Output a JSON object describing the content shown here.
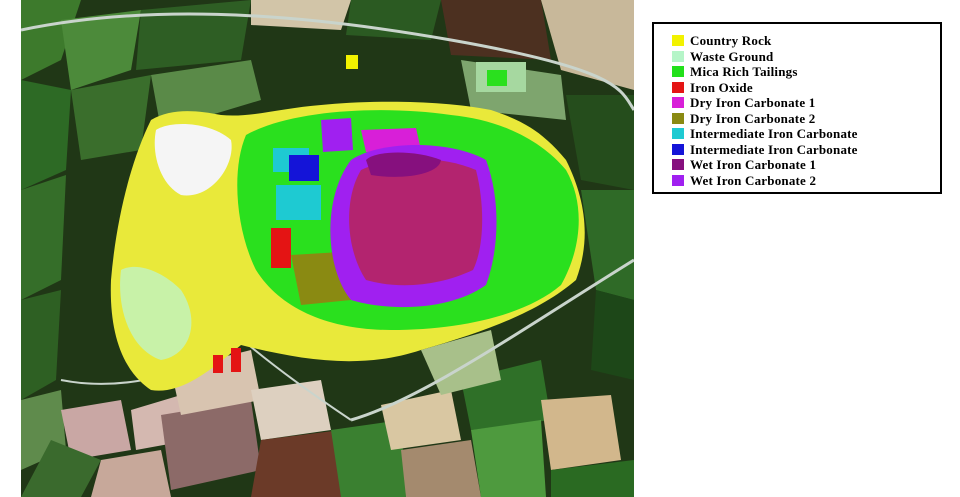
{
  "legend": {
    "items": [
      {
        "label": "Country Rock",
        "color": "#f2f200"
      },
      {
        "label": "Waste Ground",
        "color": "#b5f5c8"
      },
      {
        "label": "Mica Rich Tailings",
        "color": "#22e01a"
      },
      {
        "label": "Iron Oxide",
        "color": "#e41414"
      },
      {
        "label": "Dry Iron Carbonate 1",
        "color": "#d81fd8"
      },
      {
        "label": "Dry Iron Carbonate 2",
        "color": "#8a8a12"
      },
      {
        "label": "Intermediate Iron Carbonate",
        "color": "#1ecad2"
      },
      {
        "label": "Intermediate Iron Carbonate",
        "color": "#1414d8"
      },
      {
        "label": "Wet Iron Carbonate 1",
        "color": "#86107e"
      },
      {
        "label": "Wet Iron Carbonate 2",
        "color": "#a020f0"
      }
    ]
  },
  "map": {
    "colors": {
      "field_dark": "#1e3a17",
      "field_green": "#3f7a2e",
      "field_light": "#8fa96b",
      "field_brown": "#8c6c5a",
      "field_pink": "#c7a2a0",
      "field_tan": "#d8c8a0",
      "road": "#cfd8d0",
      "tailings_main": "#b3246f",
      "wet_carbonate": "#a020f0"
    }
  }
}
